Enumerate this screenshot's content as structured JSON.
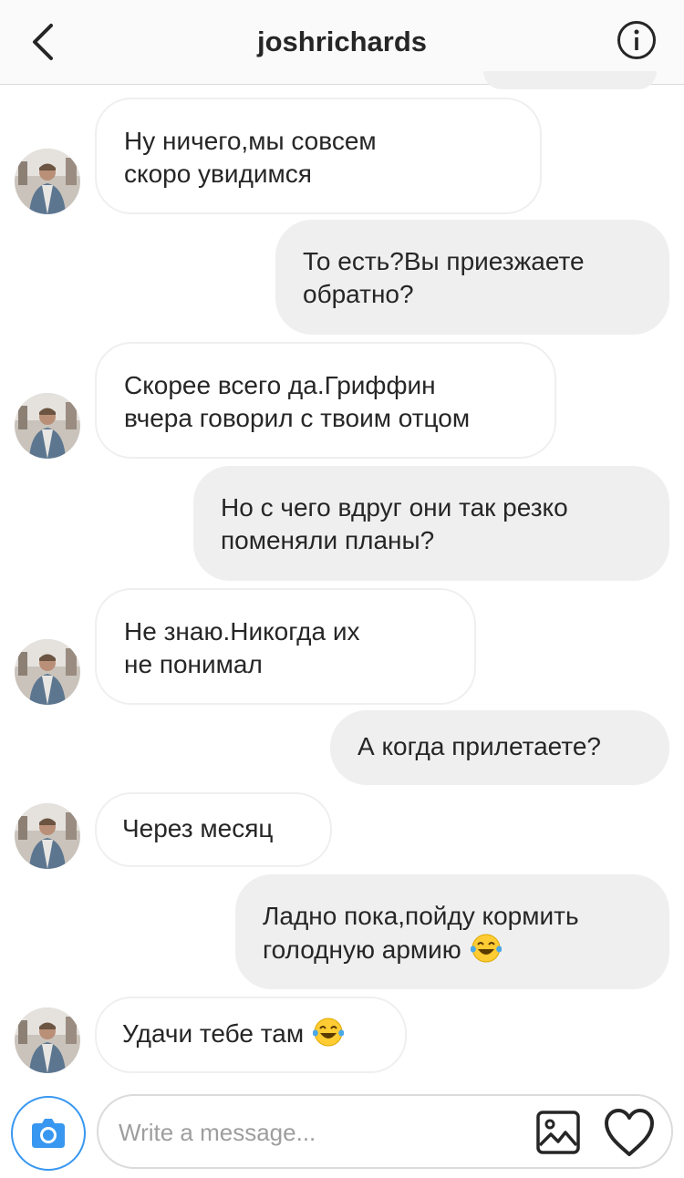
{
  "header": {
    "title": "joshrichards"
  },
  "messages": [
    {
      "direction": "in",
      "text": "Ну ничего,мы совсем скоро увидимся",
      "lines": [
        "Ну ничего,мы совсем",
        "скоро увидимся"
      ]
    },
    {
      "direction": "out",
      "text": "То есть?Вы приезжаете обратно?",
      "lines": [
        "То есть?Вы приезжаете",
        "обратно?"
      ]
    },
    {
      "direction": "in",
      "text": "Скорее всего да.Гриффин вчера говорил с твоим отцом",
      "lines": [
        "Скорее всего да.Гриффин",
        "вчера говорил с твоим отцом"
      ]
    },
    {
      "direction": "out",
      "text": "Но с чего вдруг они так резко поменяли планы?",
      "lines": [
        "Но с чего вдруг они так резко",
        "поменяли планы?"
      ]
    },
    {
      "direction": "in",
      "text": "Не знаю.Никогда их не понимал",
      "lines": [
        "Не знаю.Никогда их",
        "не понимал"
      ]
    },
    {
      "direction": "out",
      "text": "А когда прилетаете?",
      "lines": [
        "А когда прилетаете?"
      ]
    },
    {
      "direction": "in",
      "text": "Через месяц",
      "lines": [
        "Через месяц"
      ]
    },
    {
      "direction": "out",
      "text": "Ладно пока,пойду кормить голодную армию 😂",
      "lines": [
        "Ладно пока,пойду кормить",
        "голодную армию"
      ],
      "emoji": "face-with-tears-of-joy"
    },
    {
      "direction": "in",
      "text": "Удачи тебе там 😂",
      "lines": [
        "Удачи тебе там"
      ],
      "emoji": "face-with-tears-of-joy"
    }
  ],
  "composer": {
    "placeholder": "Write a message..."
  },
  "colors": {
    "accent": "#3897f0",
    "bubble_out": "#efefef",
    "bubble_in_border": "#efefef",
    "text": "#262626",
    "placeholder": "#9e9e9e"
  },
  "icons": {
    "back": "chevron-left-icon",
    "info": "info-icon",
    "camera": "camera-icon",
    "gallery": "gallery-icon",
    "like": "heart-icon",
    "emoji": "tears-of-joy-emoji"
  }
}
